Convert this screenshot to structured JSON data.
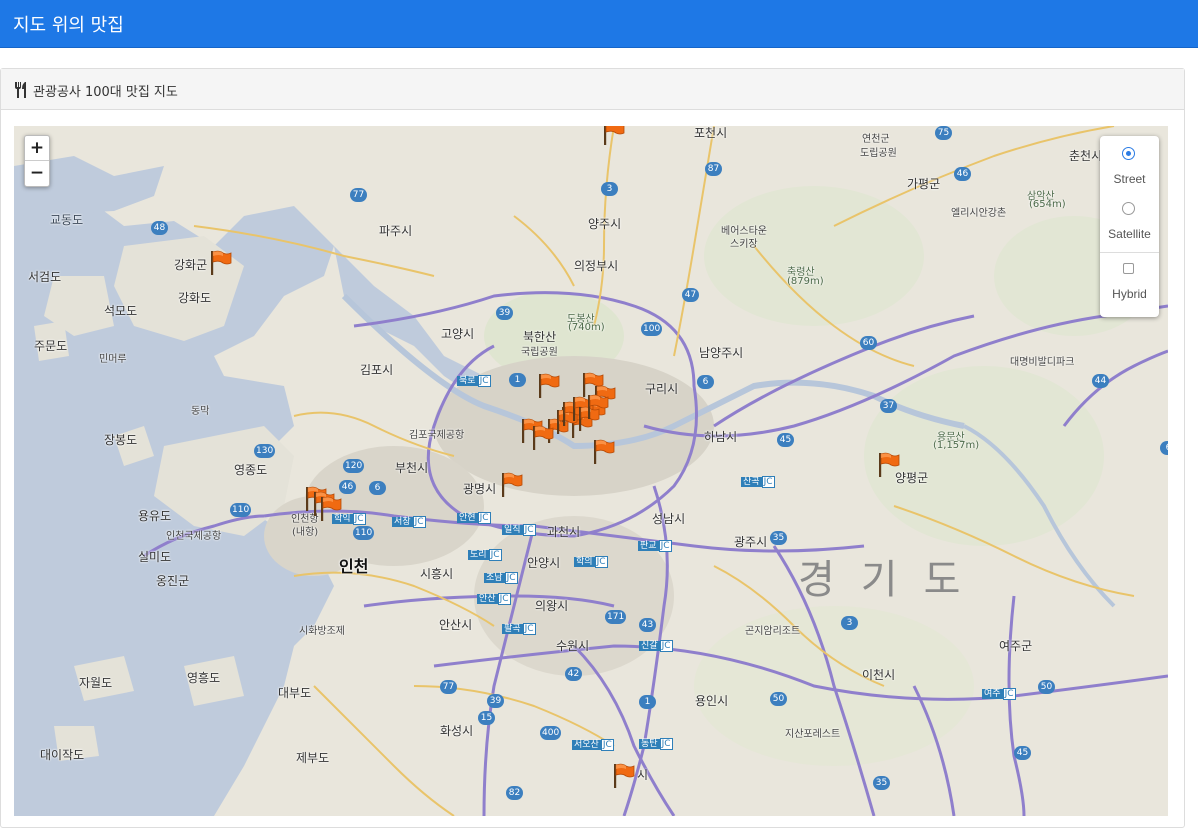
{
  "header": {
    "title": "지도 위의 맛집"
  },
  "panel": {
    "title": "관광공사 100대 맛집 지도",
    "icon": "utensils-icon"
  },
  "map": {
    "zoom_in": "+",
    "zoom_out": "−",
    "layers": {
      "street": "Street",
      "satellite": "Satellite",
      "hybrid": "Hybrid",
      "selected": "Street"
    },
    "labels": {
      "gyodongdo": "교동도",
      "ganghwagun": "강화군",
      "ganghwado": "강화도",
      "seogeomdo": "서검도",
      "seongmodo": "석모도",
      "jumundo": "주문도",
      "minmeoru": "민머루",
      "dongmak": "동막",
      "janggbongdo": "장봉도",
      "yeongjongdo": "영종도",
      "yongyudo": "용유도",
      "incheon_airport": "인천국제공항",
      "silmido": "실미도",
      "ongjingun": "옹진군",
      "jawoldo": "자월도",
      "yeongheungdo": "영흥도",
      "daebudo": "대부도",
      "daeijakdo": "대이작도",
      "jebudo": "제부도",
      "paju": "파주시",
      "yangju": "양주시",
      "uijeongbu": "의정부시",
      "goyang": "고양시",
      "gimpo": "김포시",
      "gimpo_airport": "김포국제공항",
      "bukhansan": "북한산",
      "bukhansan_park": "국립공원",
      "dobongsan": "도봉산",
      "dobongsan_h": "(740m)",
      "namyangju": "남양주시",
      "guri": "구리시",
      "hanam": "하남시",
      "bucheon": "부천시",
      "gwangmyeong": "광명시",
      "incheon": "인천",
      "incheon_port": "인천항",
      "incheon_port2": "(내항)",
      "gwacheon": "과천시",
      "seongnam": "성남시",
      "gwangju": "광주시",
      "siheung": "시흥시",
      "anyang": "안양시",
      "uiwang": "의왕시",
      "ansan": "안산시",
      "suwon": "수원시",
      "yongin": "용인시",
      "hwaseong": "화성시",
      "icheon": "이천시",
      "yeoju": "여주군",
      "yangpyeong": "양평군",
      "gapyeong": "가평군",
      "chuncheon": "춘천시",
      "sihwa": "시화방조제",
      "gyeonggido": "경기도",
      "yeoncheon": "연천군",
      "yeoncheon2": "도립공원",
      "bears": "베어스타운",
      "bears2": "스키장",
      "chukryeong": "축령산",
      "chukryeong_h": "(879m)",
      "samak": "삼악산",
      "samak_h": "(654m)",
      "elysian": "엘리시안강촌",
      "yongmun": "용문산",
      "yongmun_h": "(1,157m)",
      "daemyung": "대명비발디파크",
      "konjiam": "곤지암리조트",
      "jisan": "지산포레스트",
      "pocheon": "포천시",
      "osan": "시"
    },
    "junctions": {
      "bukro": "북로 JC",
      "hakik": "학익 JC",
      "seochang": "서창 JC",
      "anhyeon": "안현 JC",
      "ilji": "일직 JC",
      "dori": "도리 JC",
      "jonam": "조남 JC",
      "ansan": "안산 JC",
      "pangyo": "판교 JC",
      "hagui": "학의 JC",
      "singal": "신갈 JC",
      "sangok": "산곡 JC",
      "palgok": "팔곡 JC",
      "seoosan": "서오산 JC",
      "dongtan": "동탄 JC",
      "yeoju": "여주 JC"
    },
    "routes": [
      "77",
      "48",
      "3",
      "87",
      "75",
      "46",
      "47",
      "39",
      "100",
      "1",
      "60",
      "37",
      "44",
      "6",
      "45",
      "130",
      "120",
      "46",
      "6",
      "110",
      "110",
      "35",
      "171",
      "43",
      "3",
      "42",
      "1",
      "50",
      "50",
      "77",
      "39",
      "15",
      "400",
      "82",
      "45",
      "35",
      "6"
    ],
    "marker_icon": "flag-icon",
    "marker_count": 22
  }
}
